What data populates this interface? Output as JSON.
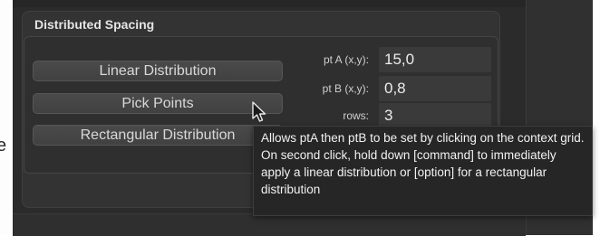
{
  "page_edge": {
    "line1": "e",
    "line2": "."
  },
  "panel": {
    "title": "Distributed Spacing"
  },
  "buttons": {
    "linear": "Linear Distribution",
    "pick": "Pick Points",
    "rect": "Rectangular Distribution"
  },
  "fields": {
    "pt_a": {
      "label": "pt A (x,y):",
      "value": "15,0"
    },
    "pt_b": {
      "label": "pt B (x,y):",
      "value": "0,8"
    },
    "rows": {
      "label": "rows:",
      "value": "3"
    }
  },
  "tooltip": {
    "text": "Allows ptA then ptB to be set by clicking on the context grid. On second click, hold down [command] to immediately apply a linear distribution or [option] for a rectangular distribution"
  },
  "icons": {
    "cursor": "arrow-cursor-icon"
  }
}
